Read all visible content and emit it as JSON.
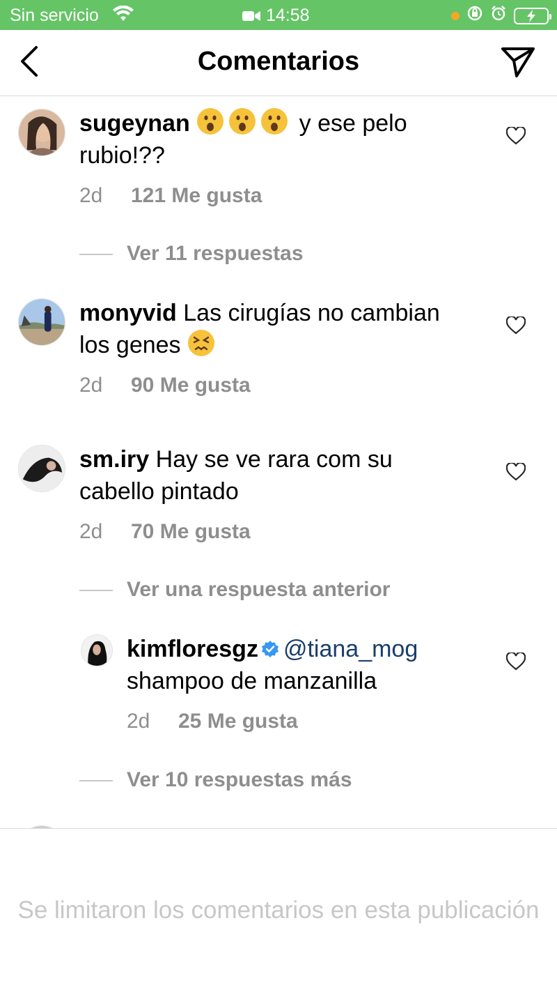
{
  "status_bar": {
    "carrier": "Sin servicio",
    "time": "14:58"
  },
  "header": {
    "title": "Comentarios"
  },
  "comments": [
    {
      "username": "sugeynan",
      "text": "y ese pelo rubio!??",
      "emoji_prefix": [
        "astonished-face-emoji",
        "astonished-face-emoji",
        "astonished-face-emoji"
      ],
      "time": "2d",
      "likes": "121 Me gusta",
      "replies_link": "Ver 11 respuestas"
    },
    {
      "username": "monyvid",
      "text": "Las cirugías no cambian los genes",
      "emoji_suffix": "persevering-face-emoji",
      "time": "2d",
      "likes": "90 Me gusta"
    },
    {
      "username": "sm.iry",
      "text": "Hay se ve rara com su cabello pintado",
      "time": "2d",
      "likes": "70 Me gusta",
      "replies_link": "Ver una respuesta anterior",
      "reply": {
        "username": "kimfloresgz",
        "verified": true,
        "mention": "@tiana_mog",
        "text": "shampoo de manzanilla",
        "time": "2d",
        "likes": "25 Me gusta"
      },
      "more_replies_link": "Ver 10 respuestas más"
    }
  ],
  "footer": {
    "limited_notice": "Se limitaron los comentarios en esta publicación"
  },
  "colors": {
    "status_bar": "#65c466",
    "secondary_text": "#8e8e8e",
    "mention": "#1a3d6d",
    "verified": "#3897f0"
  }
}
